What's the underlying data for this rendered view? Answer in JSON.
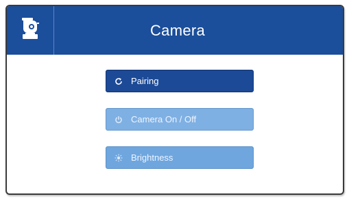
{
  "header": {
    "title": "Camera",
    "icon": "ptz-camera-icon"
  },
  "buttons": [
    {
      "label": "Pairing",
      "icon": "refresh-icon",
      "state": "active"
    },
    {
      "label": "Camera On / Off",
      "icon": "power-icon",
      "state": "inactive"
    },
    {
      "label": "Brightness",
      "icon": "sun-icon",
      "state": "inactive"
    }
  ],
  "colors": {
    "header_bg": "#1b4e9b",
    "active_button": "#1c4a96",
    "inactive_button": "#7fb0e3"
  }
}
